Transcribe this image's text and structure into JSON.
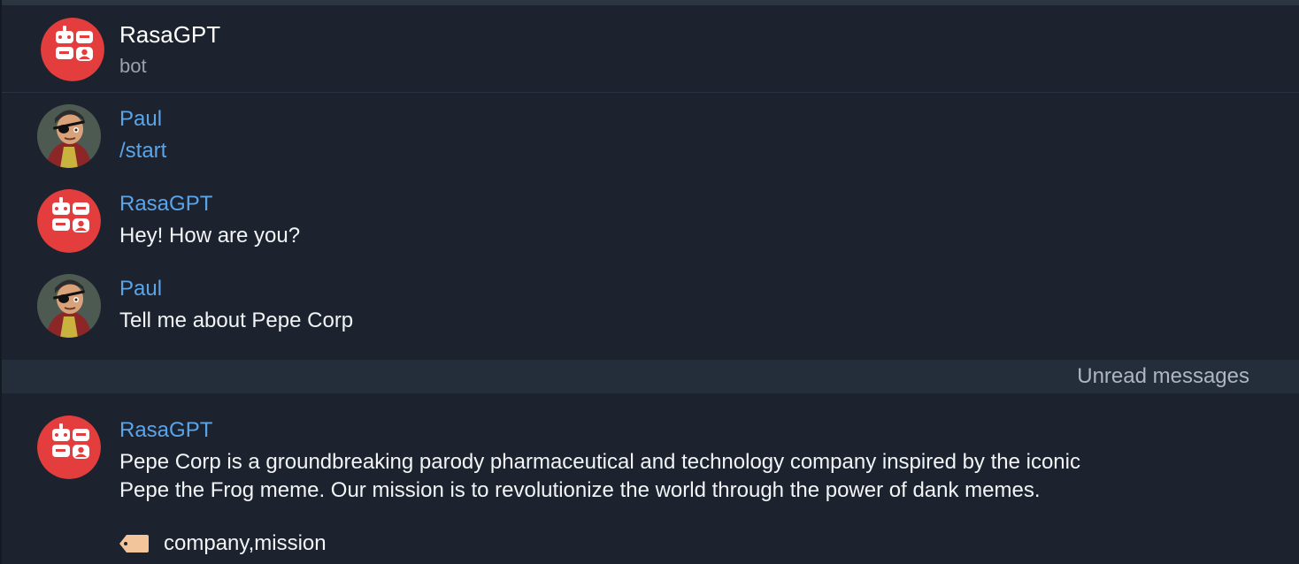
{
  "header": {
    "title": "RasaGPT",
    "subtitle": "bot",
    "avatar_icon": "robot-logo-icon"
  },
  "colors": {
    "background": "#1c232e",
    "sender": "#5aa5ea",
    "brand_red": "#e33d3d",
    "divider_bg": "#242d3a"
  },
  "messages": [
    {
      "sender": "Paul",
      "text": "/start",
      "avatar": "user-avatar-icon"
    },
    {
      "sender": "RasaGPT",
      "text": "Hey! How are you?",
      "avatar": "robot-logo-icon"
    },
    {
      "sender": "Paul",
      "text": "Tell me about Pepe Corp",
      "avatar": "user-avatar-icon"
    }
  ],
  "divider": {
    "label": "Unread messages"
  },
  "unread_message": {
    "sender": "RasaGPT",
    "text": "Pepe Corp is a groundbreaking parody pharmaceutical and technology company inspired by the iconic\nPepe the Frog meme. Our mission is to revolutionize the world through the power of dank memes.",
    "tag_icon": "tag-icon",
    "tags": "company,mission"
  }
}
